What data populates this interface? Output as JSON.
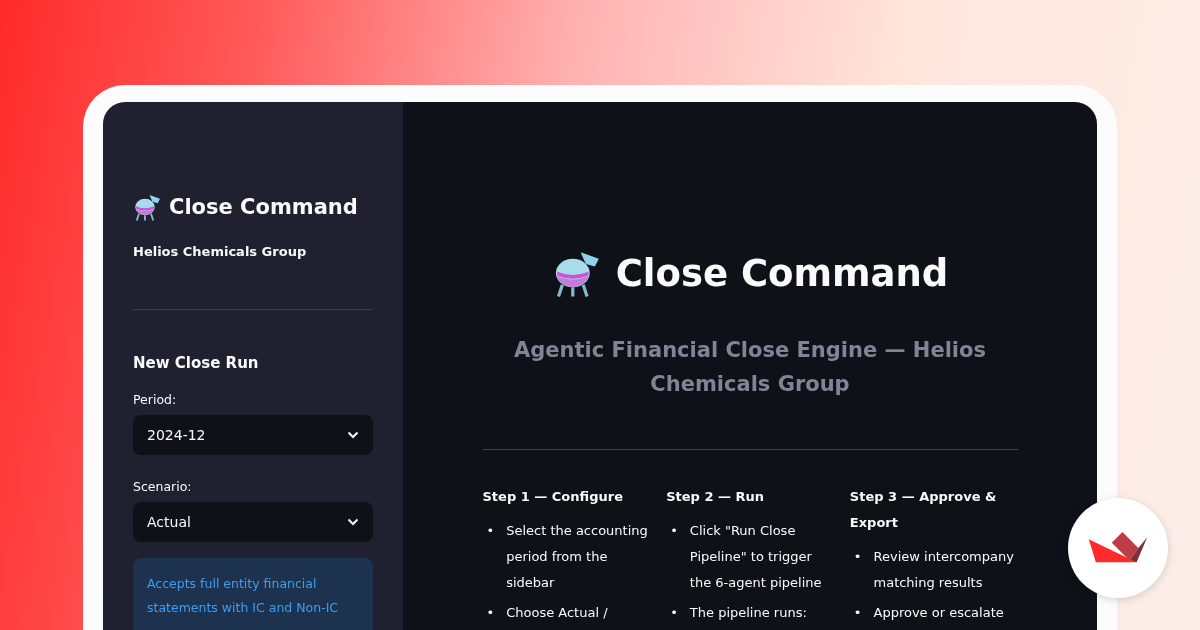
{
  "sidebar": {
    "title": "Close Command",
    "subtitle": "Helios Chemicals Group",
    "section_title": "New Close Run",
    "fields": [
      {
        "label": "Period:",
        "value": "2024-12"
      },
      {
        "label": "Scenario:",
        "value": "Actual"
      }
    ],
    "info": "Accepts full entity financial statements with IC and Non-IC"
  },
  "main": {
    "title": "Close Command",
    "subtitle": "Agentic Financial Close Engine — Helios Chemicals Group",
    "steps": [
      {
        "title": "Step 1 — Configure",
        "items": [
          {
            "marker": "•",
            "text": "Select the accounting period from the sidebar"
          },
          {
            "marker": "•",
            "text": "Choose Actual /"
          }
        ]
      },
      {
        "title": "Step 2 — Run",
        "items": [
          {
            "marker": "•",
            "text": "Click \"Run Close Pipeline\" to trigger the 6-agent pipeline"
          },
          {
            "marker": "•",
            "text": "The pipeline runs:"
          }
        ]
      },
      {
        "title": "Step 3 — Approve & Export",
        "items": [
          {
            "marker": "•",
            "text": "Review intercompany matching results"
          },
          {
            "marker": "•",
            "text": "Approve or escalate"
          }
        ]
      }
    ]
  }
}
